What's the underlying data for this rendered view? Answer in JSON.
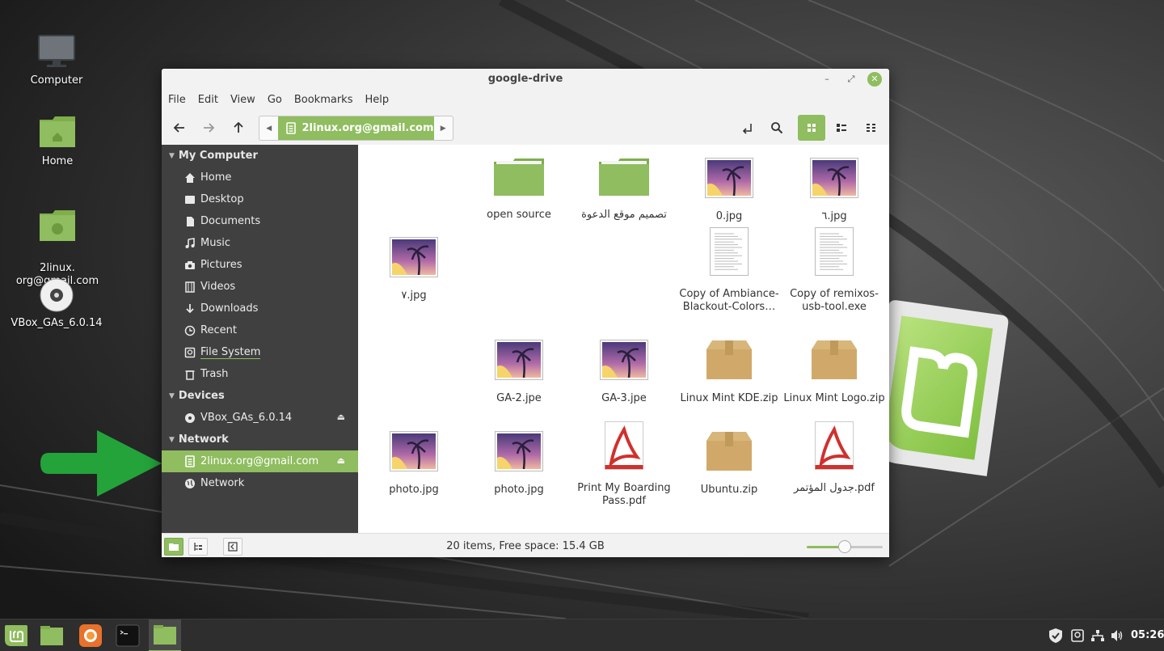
{
  "desktop": {
    "icons": [
      {
        "label": "Computer",
        "icon": "computer-icon"
      },
      {
        "label": "Home",
        "icon": "home-folder-icon"
      },
      {
        "label": "2linux.\norg@gmail.com",
        "icon": "network-folder-icon"
      },
      {
        "label": "VBox_GAs_6.0.14",
        "icon": "disc-icon"
      }
    ]
  },
  "window": {
    "title": "google-drive",
    "menu": [
      "File",
      "Edit",
      "Go",
      "Bookmarks",
      "Help"
    ],
    "path_segment": "2linux.org@gmail.com",
    "accent": "#8fbd5f"
  },
  "sidebar": {
    "sections": [
      {
        "header": "My Computer",
        "items": [
          {
            "label": "Home",
            "icon": "home-icon"
          },
          {
            "label": "Desktop",
            "icon": "desktop-icon"
          },
          {
            "label": "Documents",
            "icon": "document-icon"
          },
          {
            "label": "Music",
            "icon": "music-icon"
          },
          {
            "label": "Pictures",
            "icon": "camera-icon"
          },
          {
            "label": "Videos",
            "icon": "film-icon"
          },
          {
            "label": "Downloads",
            "icon": "download-icon"
          },
          {
            "label": "Recent",
            "icon": "clock-icon"
          },
          {
            "label": "File System",
            "icon": "harddisk-icon"
          },
          {
            "label": "Trash",
            "icon": "trash-icon"
          }
        ]
      },
      {
        "header": "Devices",
        "items": [
          {
            "label": "VBox_GAs_6.0.14",
            "icon": "disc-icon",
            "eject": true
          }
        ]
      },
      {
        "header": "Network",
        "items": [
          {
            "label": "2linux.org@gmail.com",
            "icon": "drive-icon",
            "eject": true,
            "active": true
          },
          {
            "label": "Network",
            "icon": "globe-icon"
          }
        ]
      }
    ]
  },
  "files": [
    {
      "name": "open source",
      "type": "folder"
    },
    {
      "name": "تصميم موقع الدعوة",
      "type": "folder"
    },
    {
      "name": "0.jpg",
      "type": "image"
    },
    {
      "name": "٦.jpg",
      "type": "image"
    },
    {
      "name": "٧.jpg",
      "type": "image"
    },
    {
      "name": "Copy of Ambiance-Blackout-Colors…",
      "type": "text"
    },
    {
      "name": "Copy of remixos-usb-tool.exe",
      "type": "text"
    },
    {
      "name": "GA-2.jpe",
      "type": "image"
    },
    {
      "name": "GA-3.jpe",
      "type": "image"
    },
    {
      "name": "Linux Mint KDE.zip",
      "type": "archive"
    },
    {
      "name": "Linux Mint Logo.zip",
      "type": "archive"
    },
    {
      "name": "photo.jpg",
      "type": "image"
    },
    {
      "name": "photo.jpg",
      "type": "image"
    },
    {
      "name": "Print My Boarding Pass.pdf",
      "type": "pdf"
    },
    {
      "name": "Ubuntu.zip",
      "type": "archive"
    },
    {
      "name": "جدول المؤتمر.pdf",
      "type": "pdf"
    }
  ],
  "status": {
    "text": "20 items, Free space: 15.4 GB",
    "zoom_fraction": 0.5
  },
  "panel": {
    "clock": "05:26"
  }
}
